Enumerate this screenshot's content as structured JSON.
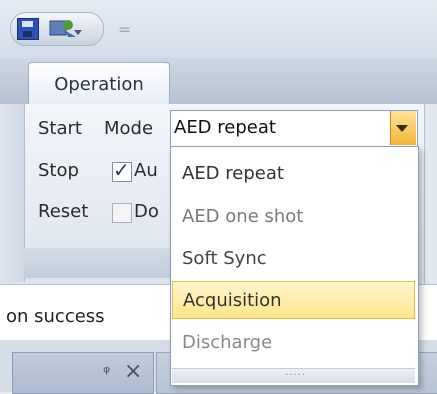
{
  "quick_access": {
    "save_icon": "save-icon",
    "run_icon": "run-icon",
    "separator": "="
  },
  "ribbon": {
    "tab_label": "Operation",
    "labels": {
      "start": "Start",
      "mode": "Mode",
      "stop": "Stop",
      "reset": "Reset",
      "auto_partial": "Au",
      "do_partial": "Do"
    },
    "auto_checked": true,
    "do_checked": false,
    "mode_combo": {
      "selected": "AED repeat"
    }
  },
  "dropdown": {
    "options": [
      "AED repeat",
      "AED one shot",
      "Soft Sync",
      "Acquisition",
      "Discharge"
    ],
    "highlighted": "Acquisition",
    "grip": "....."
  },
  "status": {
    "text": "on success"
  },
  "pane": {
    "pin_glyph": "ᵠ",
    "close_glyph": "×"
  },
  "colors": {
    "highlight": "#ffe58a",
    "combo_button": "#f3b63a"
  }
}
